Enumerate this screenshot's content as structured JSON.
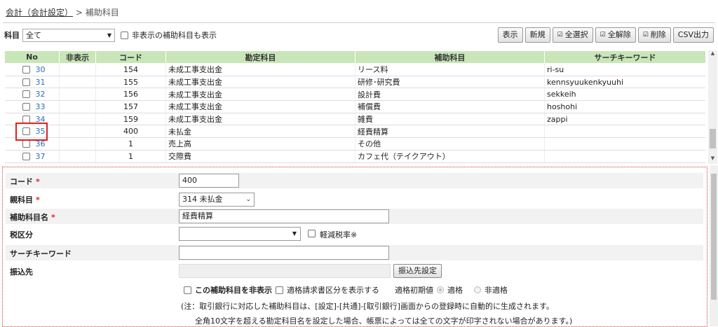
{
  "breadcrumb": {
    "link": "会計（会計設定）",
    "sep": ">",
    "current": "補助科目"
  },
  "filter": {
    "label": "科目",
    "value": "全て",
    "show_hidden_label": "非表示の補助科目も表示"
  },
  "toolbar": {
    "show": "表示",
    "new": "新規",
    "select_all": "全選択",
    "deselect_all": "全解除",
    "delete": "削除",
    "csv": "CSV出力"
  },
  "table": {
    "headers": [
      "No",
      "非表示",
      "コード",
      "勘定科目",
      "補助科目",
      "サーチキーワード"
    ],
    "rows": [
      {
        "no": "30",
        "code": "154",
        "account": "未成工事支出金",
        "sub": "リース料",
        "keyword": "ri-su"
      },
      {
        "no": "31",
        "code": "155",
        "account": "未成工事支出金",
        "sub": "研修･研究費",
        "keyword": "kennsyuukenkyuuhi"
      },
      {
        "no": "32",
        "code": "156",
        "account": "未成工事支出金",
        "sub": "設計費",
        "keyword": "sekkeih"
      },
      {
        "no": "33",
        "code": "157",
        "account": "未成工事支出金",
        "sub": "補償費",
        "keyword": "hoshohi"
      },
      {
        "no": "34",
        "code": "159",
        "account": "未成工事支出金",
        "sub": "雑費",
        "keyword": "zappi"
      },
      {
        "no": "35",
        "code": "400",
        "account": "未払金",
        "sub": "経費精算",
        "keyword": ""
      },
      {
        "no": "36",
        "code": "1",
        "account": "売上高",
        "sub": "その他",
        "keyword": ""
      },
      {
        "no": "37",
        "code": "1",
        "account": "交際費",
        "sub": "カフェ代（テイクアウト）",
        "keyword": ""
      }
    ]
  },
  "form": {
    "code_label": "コード",
    "code_value": "400",
    "parent_label": "親科目",
    "parent_value": "314 未払金",
    "sub_name_label": "補助科目名",
    "sub_name_value": "経費精算",
    "tax_label": "税区分",
    "tax_value": "",
    "reduced_rate_label": "軽減税率※",
    "keyword_label": "サーチキーワード",
    "keyword_value": "",
    "transfer_label": "振込先",
    "transfer_value": "",
    "transfer_button": "振込先設定",
    "hide_label": "この補助科目を非表示",
    "invoice_label": "適格請求書区分を表示する",
    "initial_label": "適格初期値",
    "qualified_label": "適格",
    "non_qualified_label": "非適格",
    "required_mark": "*",
    "note1": "(注：取引銀行に対応した補助科目は、[設定]-[共通]-[取引銀行]画面からの登録時に自動的に生成されます。",
    "note2": "全角10文字を超える勘定科目名を設定した場合、帳票によっては全ての文字が印字されない場合があります。)"
  },
  "icons": {
    "dropdown": "chevron-down-icon",
    "check": "checkbox-icon",
    "delete": "trash-icon"
  }
}
